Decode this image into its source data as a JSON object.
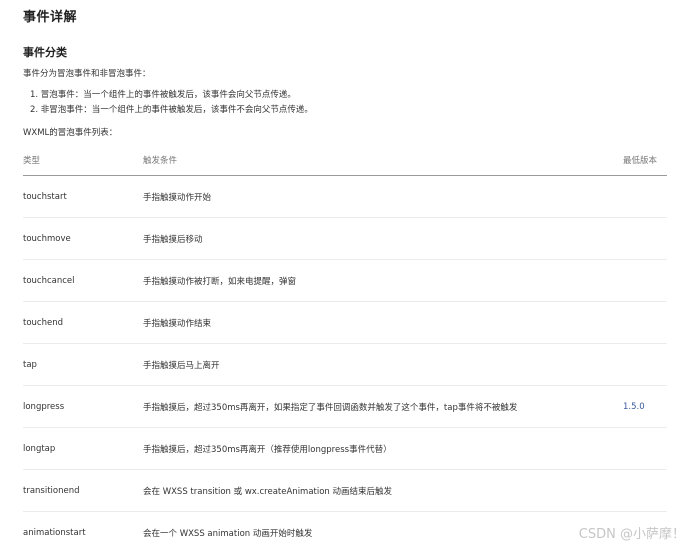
{
  "page_title": "事件详解",
  "section_title": "事件分类",
  "intro": "事件分为冒泡事件和非冒泡事件：",
  "list": [
    "1. 冒泡事件：当一个组件上的事件被触发后，该事件会向父节点传递。",
    "2. 非冒泡事件：当一个组件上的事件被触发后，该事件不会向父节点传递。"
  ],
  "wxml_intro": "WXML的冒泡事件列表：",
  "table": {
    "headers": [
      "类型",
      "触发条件",
      "最低版本"
    ],
    "rows": [
      {
        "type": "touchstart",
        "cond": "手指触摸动作开始",
        "ver": ""
      },
      {
        "type": "touchmove",
        "cond": "手指触摸后移动",
        "ver": ""
      },
      {
        "type": "touchcancel",
        "cond": "手指触摸动作被打断，如来电提醒，弹窗",
        "ver": ""
      },
      {
        "type": "touchend",
        "cond": "手指触摸动作结束",
        "ver": ""
      },
      {
        "type": "tap",
        "cond": "手指触摸后马上离开",
        "ver": ""
      },
      {
        "type": "longpress",
        "cond": "手指触摸后，超过350ms再离开，如果指定了事件回调函数并触发了这个事件，tap事件将不被触发",
        "ver": "1.5.0"
      },
      {
        "type": "longtap",
        "cond": "手指触摸后，超过350ms再离开（推荐使用longpress事件代替）",
        "ver": ""
      },
      {
        "type": "transitionend",
        "cond": "会在 WXSS transition 或 wx.createAnimation 动画结束后触发",
        "ver": ""
      },
      {
        "type": "animationstart",
        "cond": "会在一个 WXSS animation 动画开始时触发",
        "ver": ""
      }
    ]
  },
  "watermark": "CSDN @小萨摩！"
}
